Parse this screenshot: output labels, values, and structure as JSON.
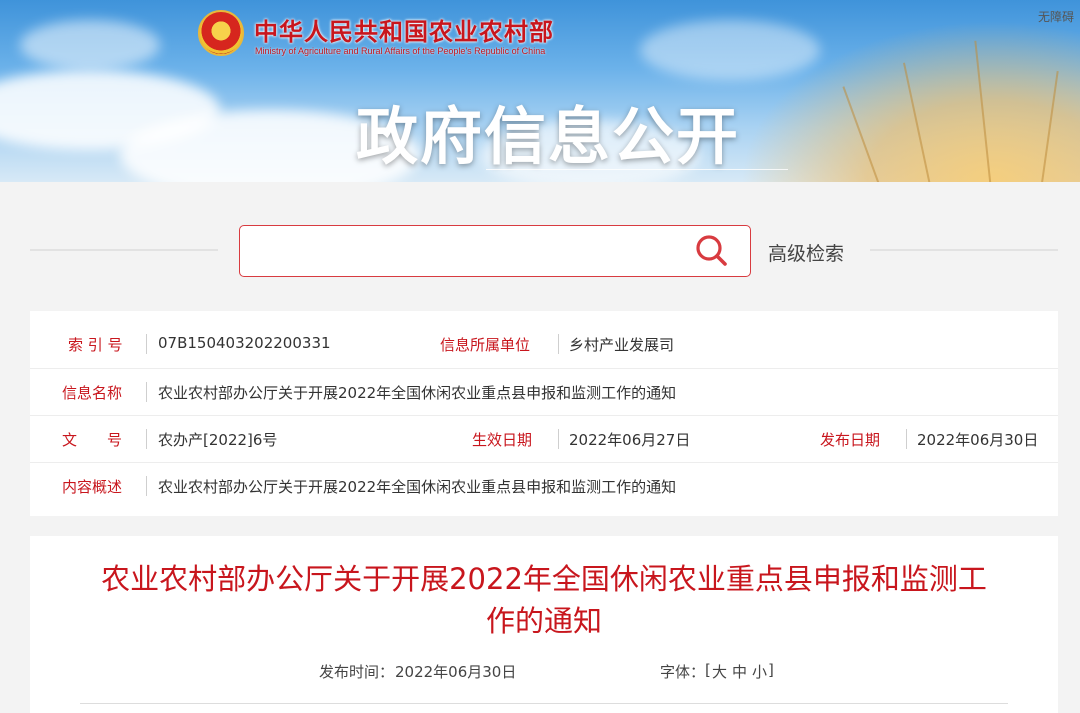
{
  "header": {
    "ministry_cn": "中华人民共和国农业农村部",
    "ministry_en": "Ministry of Agriculture and Rural Affairs of the People's Republic of China",
    "section_title": "政府信息公开",
    "accessibility": "无障碍"
  },
  "search": {
    "placeholder": "",
    "advanced_label": "高级检索"
  },
  "meta": {
    "index_label": "索 引 号",
    "index_value": "07B150403202200331",
    "unit_label": "信息所属单位",
    "unit_value": "乡村产业发展司",
    "name_label": "信息名称",
    "name_value": "农业农村部办公厅关于开展2022年全国休闲农业重点县申报和监测工作的通知",
    "docno_label": "文　　号",
    "docno_value": "农办产[2022]6号",
    "effective_label": "生效日期",
    "effective_value": "2022年06月27日",
    "publish_label": "发布日期",
    "publish_value": "2022年06月30日",
    "summary_label": "内容概述",
    "summary_value": "农业农村部办公厅关于开展2022年全国休闲农业重点县申报和监测工作的通知"
  },
  "article": {
    "title": "农业农村部办公厅关于开展2022年全国休闲农业重点县申报和监测工作的通知",
    "pub_label": "发布时间：",
    "pub_date": "2022年06月30日",
    "font_label": "字体：",
    "font_open": "[",
    "font_large": "大",
    "font_medium": "中",
    "font_small": "小",
    "font_close": "]"
  },
  "colors": {
    "accent_red": "#c8161d",
    "search_border": "#d83b40"
  }
}
